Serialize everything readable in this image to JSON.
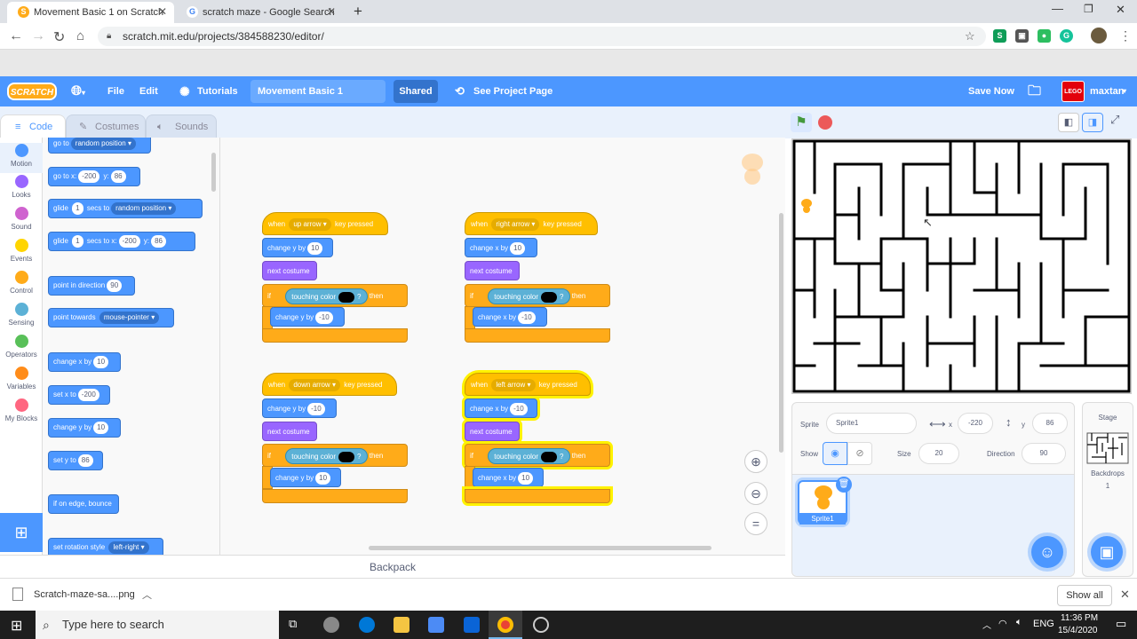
{
  "browser": {
    "tabs": [
      {
        "title": "Movement Basic 1 on Scratch",
        "icon": "scratch-favicon"
      },
      {
        "title": "scratch maze - Google Search",
        "icon": "google-favicon"
      }
    ],
    "url": "scratch.mit.edu/projects/384588230/editor/"
  },
  "menubar": {
    "logo": "SCRATCH",
    "file": "File",
    "edit": "Edit",
    "tutorials": "Tutorials",
    "project_title": "Movement Basic 1",
    "shared": "Shared",
    "see_project_page": "See Project Page",
    "save_now": "Save Now",
    "username": "maxtan",
    "avatar_text": "LEGO"
  },
  "editor_tabs": {
    "code": "Code",
    "costumes": "Costumes",
    "sounds": "Sounds"
  },
  "categories": [
    {
      "label": "Motion",
      "color": "#4c97ff"
    },
    {
      "label": "Looks",
      "color": "#9966ff"
    },
    {
      "label": "Sound",
      "color": "#cf63cf"
    },
    {
      "label": "Events",
      "color": "#ffd500"
    },
    {
      "label": "Control",
      "color": "#ffab19"
    },
    {
      "label": "Sensing",
      "color": "#5cb1d6"
    },
    {
      "label": "Operators",
      "color": "#59c059"
    },
    {
      "label": "Variables",
      "color": "#ff8c1a"
    },
    {
      "label": "My Blocks",
      "color": "#ff6680"
    }
  ],
  "palette": {
    "goto": {
      "label": "go to",
      "target": "random position"
    },
    "gotoxy": {
      "label": "go to x:",
      "x": "-200",
      "ylabel": "y:",
      "y": "86"
    },
    "glide1": {
      "label": "glide",
      "secs": "1",
      "mid": "secs to",
      "target": "random position"
    },
    "glide2": {
      "label": "glide",
      "secs": "1",
      "mid": "secs to x:",
      "x": "-200",
      "ylabel": "y:",
      "y": "86"
    },
    "point_dir": {
      "label": "point in direction",
      "value": "90"
    },
    "point_towards": {
      "label": "point towards",
      "target": "mouse-pointer"
    },
    "change_x": {
      "label": "change x by",
      "value": "10"
    },
    "set_x": {
      "label": "set x to",
      "value": "-200"
    },
    "change_y": {
      "label": "change y by",
      "value": "10"
    },
    "set_y": {
      "label": "set y to",
      "value": "86"
    },
    "bounce": {
      "label": "if on edge, bounce"
    },
    "rotation": {
      "label": "set rotation style",
      "value": "left-right"
    }
  },
  "scripts": [
    {
      "key": "up arrow",
      "move": "change y by",
      "move_val": "10",
      "back_move": "change y by",
      "back_val": "-10"
    },
    {
      "key": "right arrow",
      "move": "change x by",
      "move_val": "10",
      "back_move": "change x by",
      "back_val": "-10"
    },
    {
      "key": "down arrow",
      "move": "change y by",
      "move_val": "-10",
      "back_move": "change y by",
      "back_val": "10"
    },
    {
      "key": "left arrow",
      "move": "change x by",
      "move_val": "-10",
      "back_move": "change x by",
      "back_val": "10"
    }
  ],
  "script_text": {
    "when": "when",
    "key_pressed": "key pressed",
    "next_costume": "next costume",
    "if": "if",
    "then": "then",
    "touching_color": "touching color",
    "question": "?"
  },
  "workspace": {
    "backpack": "Backpack"
  },
  "sprite_info": {
    "sprite_label": "Sprite",
    "sprite_name": "Sprite1",
    "x_label": "x",
    "x": "-220",
    "y_label": "y",
    "y": "86",
    "show_label": "Show",
    "size_label": "Size",
    "size": "20",
    "direction_label": "Direction",
    "direction": "90",
    "thumb_name": "Sprite1"
  },
  "stage_pane": {
    "title": "Stage",
    "backdrops_label": "Backdrops",
    "backdrops_count": "1"
  },
  "downloads": {
    "file": "Scratch-maze-sa....png",
    "show_all": "Show all"
  },
  "taskbar": {
    "search": "Type here to search",
    "lang": "ENG",
    "time": "11:36 PM",
    "date": "15/4/2020"
  }
}
